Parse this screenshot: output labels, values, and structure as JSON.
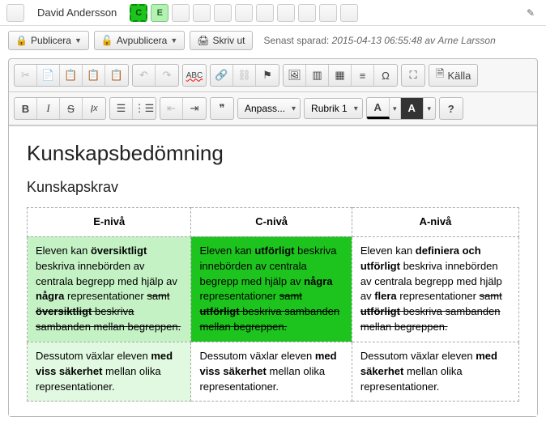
{
  "top": {
    "student": "David Andersson",
    "grades": {
      "c": "C",
      "e": "E"
    }
  },
  "actions": {
    "publish": "Publicera",
    "unpublish": "Avpublicera",
    "print": "Skriv ut",
    "saved_label": "Senast sparad:",
    "saved_ts": "2015-04-13 06:55:48",
    "saved_by_prefix": "av",
    "saved_by": "Arne Larsson"
  },
  "toolbar": {
    "source": "Källa",
    "font": "Anpass...",
    "heading": "Rubrik 1",
    "text_color": "A",
    "bg_color": "A",
    "help": "?",
    "b": "B",
    "i": "I",
    "s": "S",
    "tx": "Tₓ",
    "abc": "ABC",
    "omega": "Ω",
    "quote": "❞"
  },
  "doc": {
    "h1": "Kunskapsbedömning",
    "h2": "Kunskapskrav",
    "headers": {
      "e": "E-nivå",
      "c": "C-nivå",
      "a": "A-nivå"
    },
    "rows": [
      {
        "e": "Eleven kan <strong>översiktligt</strong> beskriva innebörden av centrala begrepp med hjälp av <strong>några</strong> representationer <s>samt</s> <s><strong>översiktligt</strong> beskriva sambanden mellan begreppen.</s>",
        "c": "Eleven kan <strong>utförligt</strong> beskriva innebörden av centrala begrepp med hjälp av <strong>några</strong> representationer <s>samt <strong>utförligt</strong> beskriva sambanden mellan begreppen.</s>",
        "a": "Eleven kan <strong>definiera och utförligt</strong> beskriva innebörden av centrala begrepp med hjälp av <strong>flera</strong> representationer <s>samt <strong>utförligt</strong> beskriva sambanden mellan begreppen.</s>"
      },
      {
        "e": "Dessutom växlar eleven <strong>med viss säkerhet</strong> mellan olika representationer.",
        "c": "Dessutom växlar eleven <strong>med viss säkerhet</strong> mellan olika representationer.",
        "a": "Dessutom växlar eleven <strong>med säkerhet</strong> mellan olika representationer."
      }
    ]
  }
}
